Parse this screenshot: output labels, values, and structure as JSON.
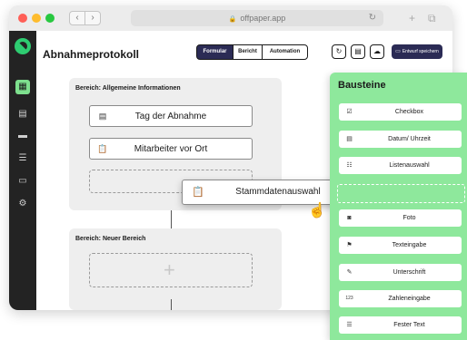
{
  "browser": {
    "url": "offpaper.app",
    "icons": {
      "back": "chevron-left-icon",
      "forward": "chevron-right-icon",
      "lock": "lock-icon",
      "reload": "reload-icon",
      "new_tab": "plus-icon",
      "tabs": "tabs-icon"
    },
    "traffic_lights": [
      "#ff5f57",
      "#febc2e",
      "#28c840"
    ]
  },
  "sidebar": {
    "items": [
      {
        "icon": "dashboard-icon",
        "active": true
      },
      {
        "icon": "document-icon",
        "active": false
      },
      {
        "icon": "card-icon",
        "active": false
      },
      {
        "icon": "database-icon",
        "active": false
      },
      {
        "icon": "folder-icon",
        "active": false
      },
      {
        "icon": "settings-icon",
        "active": false
      }
    ]
  },
  "header": {
    "title": "Abnahmeprotokoll",
    "tabs": [
      {
        "label": "Formular",
        "active": true
      },
      {
        "label": "Bericht",
        "active": false
      },
      {
        "label": "Automation",
        "active": false
      }
    ],
    "actions": [
      "history-icon",
      "document-icon",
      "cloud-icon"
    ],
    "save_label": "Entwurf speichern"
  },
  "sections": [
    {
      "title": "Bereich: Allgemeine Informationen",
      "fields": [
        {
          "label": "Tag der Abnahme",
          "icon": "calendar-icon"
        },
        {
          "label": "Mitarbeiter vor Ort",
          "icon": "clipboard-icon"
        }
      ]
    },
    {
      "title": "Bereich: Neuer Bereich",
      "fields": []
    }
  ],
  "dragging": {
    "label": "Stammdatenauswahl",
    "icon": "clipboard-icon"
  },
  "panel": {
    "title": "Bausteine",
    "blocks": [
      {
        "label": "Checkbox",
        "icon": "checkbox-icon"
      },
      {
        "label": "Datum/ Uhrzeit",
        "icon": "calendar-icon"
      },
      {
        "label": "Listenauswahl",
        "icon": "list-icon"
      },
      {
        "label": "Foto",
        "icon": "camera-icon"
      },
      {
        "label": "Texteingabe",
        "icon": "text-input-icon"
      },
      {
        "label": "Unterschrift",
        "icon": "signature-icon"
      },
      {
        "label": "Zahleneingabe",
        "icon": "number-icon",
        "glyph": "123"
      },
      {
        "label": "Fester Text",
        "icon": "text-block-icon"
      }
    ]
  },
  "colors": {
    "accent": "#8ee89c",
    "primary": "#2b2b55",
    "sidebar": "#232323"
  }
}
